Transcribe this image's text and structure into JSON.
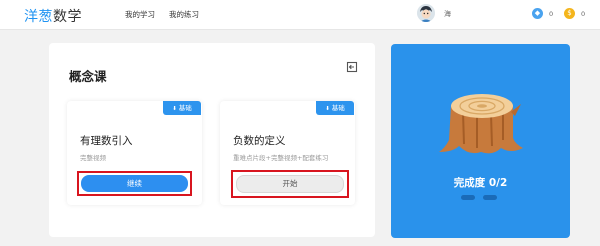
{
  "app": {
    "logo_part1": "洋葱",
    "logo_part2": "数学"
  },
  "nav": {
    "my_learning": "我的学习",
    "my_practice": "我的练习"
  },
  "user": {
    "name": "海"
  },
  "currencies": [
    {
      "icon": "blue-gem-icon",
      "color": "#4aa3ef",
      "count": "0"
    },
    {
      "icon": "gold-coin-icon",
      "color": "#f4b51c",
      "count": "0"
    }
  ],
  "section": {
    "title": "概念课"
  },
  "lessons": [
    {
      "badge": "基础",
      "title": "有理数引入",
      "subtitle": "完整视频",
      "button": "继续",
      "button_style": "primary",
      "highlighted": true
    },
    {
      "badge": "基础",
      "title": "负数的定义",
      "subtitle": "重难点片段+完整视频+配套练习",
      "button": "开始",
      "button_style": "secondary",
      "highlighted": true
    }
  ],
  "progress": {
    "label": "完成度 0/2",
    "completed": 0,
    "total": 2,
    "illustration": "tree-stump-icon"
  },
  "colors": {
    "accent": "#2d8ff0",
    "panel": "#2a92eb",
    "highlight": "#d8151f"
  }
}
